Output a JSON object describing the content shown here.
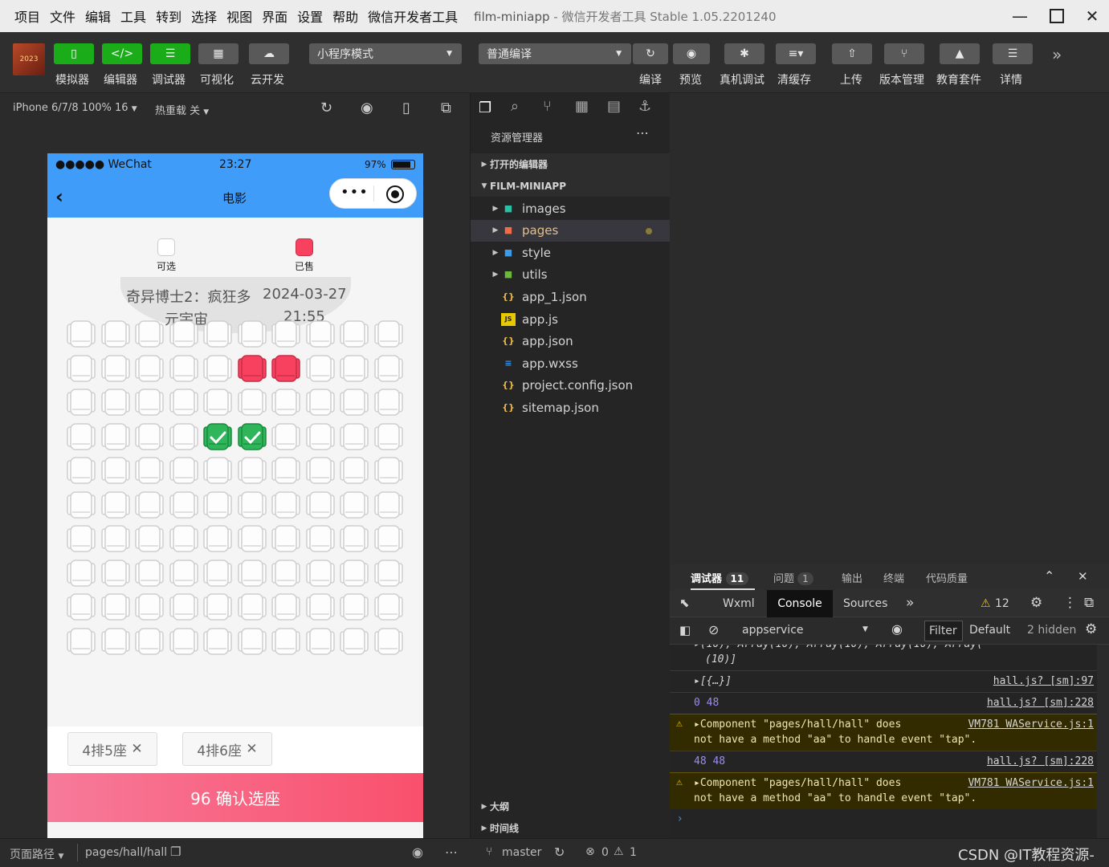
{
  "menu": {
    "items": [
      "项目",
      "文件",
      "编辑",
      "工具",
      "转到",
      "选择",
      "视图",
      "界面",
      "设置",
      "帮助",
      "微信开发者工具"
    ],
    "window_title": "film-miniapp",
    "window_subtitle": "- 微信开发者工具 Stable 1.05.2201240"
  },
  "toolbar": {
    "simulator": "模拟器",
    "editor": "编辑器",
    "debugger": "调试器",
    "visualize": "可视化",
    "cloud": "云开发",
    "mode_select": "小程序模式",
    "compile_select": "普通编译",
    "compile": "编译",
    "preview": "预览",
    "device_debug": "真机调试",
    "clear_cache": "清缓存",
    "upload": "上传",
    "version": "版本管理",
    "education": "教育套件",
    "details": "详情",
    "avatar_text": "2023"
  },
  "simbar": {
    "device": "iPhone 6/7/8 100% 16",
    "hot_reload": "热重载 关"
  },
  "phone": {
    "carrier": "●●●●● WeChat",
    "time": "23:27",
    "battery": "97%",
    "title": "电影",
    "legend_available": "可选",
    "legend_sold": "已售",
    "movie_title_1": "奇异博士2：疯狂多",
    "movie_title_2": "元宇宙",
    "show_date": "2024-03-27",
    "show_time": "21:55",
    "rows": 10,
    "cols": 10,
    "sold_seats": [
      [
        2,
        6
      ],
      [
        2,
        7
      ]
    ],
    "selected_seats": [
      [
        4,
        5
      ],
      [
        4,
        6
      ]
    ],
    "chips": [
      "4排5座",
      "4排6座"
    ],
    "confirm": "96 确认选座"
  },
  "explorer": {
    "header": "资源管理器",
    "open_editors": "打开的编辑器",
    "project": "FILM-MINIAPP",
    "items": [
      {
        "name": "images",
        "type": "folder"
      },
      {
        "name": "pages",
        "type": "folder"
      },
      {
        "name": "style",
        "type": "folder"
      },
      {
        "name": "utils",
        "type": "folder"
      },
      {
        "name": "app_1.json",
        "type": "json"
      },
      {
        "name": "app.js",
        "type": "js"
      },
      {
        "name": "app.json",
        "type": "json"
      },
      {
        "name": "app.wxss",
        "type": "wxss"
      },
      {
        "name": "project.config.json",
        "type": "json"
      },
      {
        "name": "sitemap.json",
        "type": "json"
      }
    ],
    "outline": "大纲",
    "timeline": "时间线"
  },
  "devtools": {
    "tabs": [
      {
        "label": "调试器",
        "badge": "11"
      },
      {
        "label": "问题",
        "badge": "1"
      },
      {
        "label": "输出",
        "badge": ""
      },
      {
        "label": "终端",
        "badge": ""
      },
      {
        "label": "代码质量",
        "badge": ""
      }
    ],
    "subtabs": [
      "Wxml",
      "Console",
      "Sources"
    ],
    "warn_count": "12",
    "context": "appservice",
    "filter": "Filter",
    "level": "Default",
    "hidden": "2 hidden",
    "lines": [
      {
        "text1": "▸(10), Array(10), Array(10), Array(10), Array(",
        "text2": "(10)]",
        "src": "",
        "warn": false
      },
      {
        "text1": "▸[{…}]",
        "text2": "",
        "src": "hall.js? [sm]:97",
        "warn": false
      },
      {
        "text1": "0 48",
        "text2": "",
        "src": "hall.js? [sm]:228",
        "warn": false
      },
      {
        "text1": "▸Component \"pages/hall/hall\" does",
        "text2": "not have a method \"aa\" to handle event \"tap\".",
        "src": "VM781 WAService.js:1",
        "warn": true
      },
      {
        "text1": "48 48",
        "text2": "",
        "src": "hall.js? [sm]:228",
        "warn": false
      },
      {
        "text1": "▸Component \"pages/hall/hall\" does",
        "text2": "not have a method \"aa\" to handle event \"tap\".",
        "src": "VM781 WAService.js:1",
        "warn": true
      }
    ]
  },
  "status": {
    "page_path_label": "页面路径",
    "page_path": "pages/hall/hall",
    "branch": "master",
    "errors": "0",
    "warnings": "1",
    "watermark": "CSDN @IT教程资源-"
  }
}
